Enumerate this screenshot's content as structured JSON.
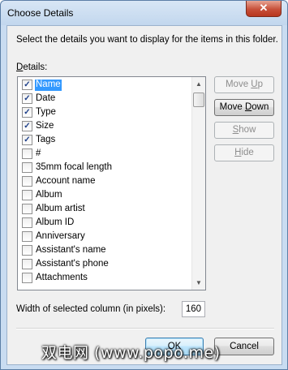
{
  "window": {
    "title": "Choose Details",
    "close_glyph": "✕"
  },
  "instruction": "Select the details you want to display for the items in this folder.",
  "details_label": {
    "mnemonic": "D",
    "rest": "etails:"
  },
  "list": {
    "selected_index": 0,
    "items": [
      {
        "label": "Name",
        "checked": true
      },
      {
        "label": "Date",
        "checked": true
      },
      {
        "label": "Type",
        "checked": true
      },
      {
        "label": "Size",
        "checked": true
      },
      {
        "label": "Tags",
        "checked": true
      },
      {
        "label": "#",
        "checked": false
      },
      {
        "label": "35mm focal length",
        "checked": false
      },
      {
        "label": "Account name",
        "checked": false
      },
      {
        "label": "Album",
        "checked": false
      },
      {
        "label": "Album artist",
        "checked": false
      },
      {
        "label": "Album ID",
        "checked": false
      },
      {
        "label": "Anniversary",
        "checked": false
      },
      {
        "label": "Assistant's name",
        "checked": false
      },
      {
        "label": "Assistant's phone",
        "checked": false
      },
      {
        "label": "Attachments",
        "checked": false
      }
    ],
    "scroll_position": 0.05
  },
  "buttons": {
    "move_up": {
      "mnemonic": "U",
      "pre": "Move ",
      "post": "p",
      "enabled": false
    },
    "move_down": {
      "mnemonic": "D",
      "pre": "Move ",
      "post": "own",
      "enabled": true
    },
    "show": {
      "mnemonic": "S",
      "pre": "",
      "post": "how",
      "enabled": false
    },
    "hide": {
      "mnemonic": "H",
      "pre": "",
      "post": "ide",
      "enabled": false
    },
    "ok": "OK",
    "cancel": "Cancel"
  },
  "width_field": {
    "label": "Width of selected column (in pixels):",
    "value": "160"
  },
  "watermark": "双电网 (www.popo.me)",
  "colors": {
    "selection": "#3399ff",
    "close_button": "#c7503a",
    "default_button_border": "#3c7fb1"
  }
}
